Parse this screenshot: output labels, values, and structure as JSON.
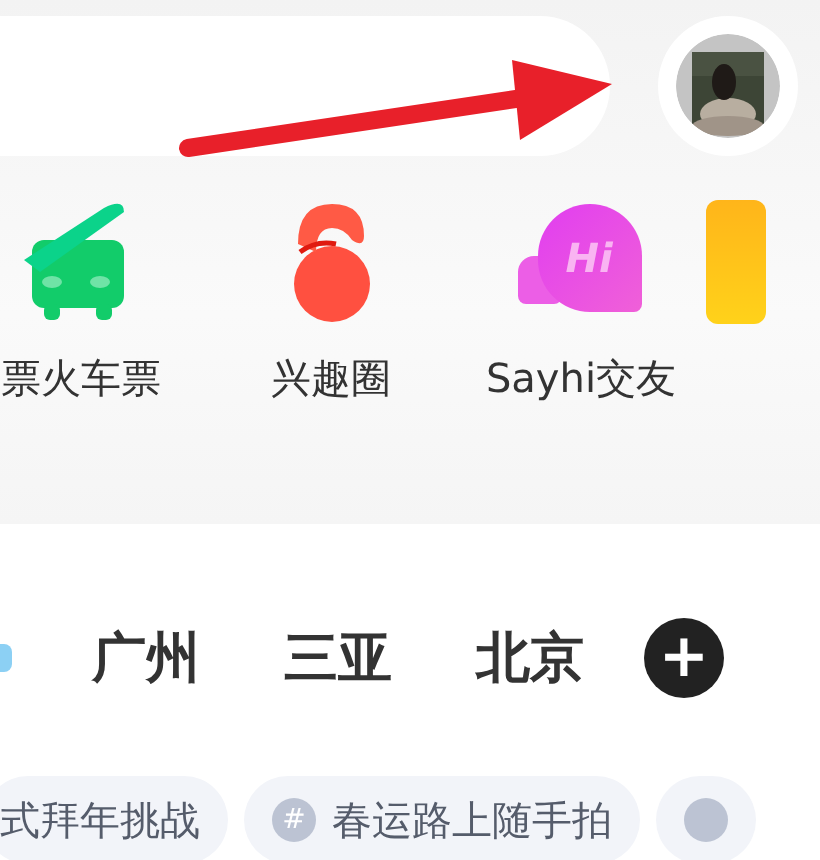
{
  "shortcuts": [
    {
      "kind": "train",
      "label": "票火车票"
    },
    {
      "kind": "interest",
      "label": "兴趣圈"
    },
    {
      "kind": "sayhi",
      "label": "Sayhi交友",
      "icon_text": "Hi"
    },
    {
      "kind": "travel"
    }
  ],
  "cities": [
    {
      "label": "广州"
    },
    {
      "label": "三亚"
    },
    {
      "label": "北京"
    }
  ],
  "add_button": "+",
  "topics": [
    {
      "label": "式拜年挑战",
      "hash": false
    },
    {
      "label": "春运路上随手拍",
      "hash": true,
      "hash_text": "#"
    },
    {
      "hash": true
    }
  ]
}
